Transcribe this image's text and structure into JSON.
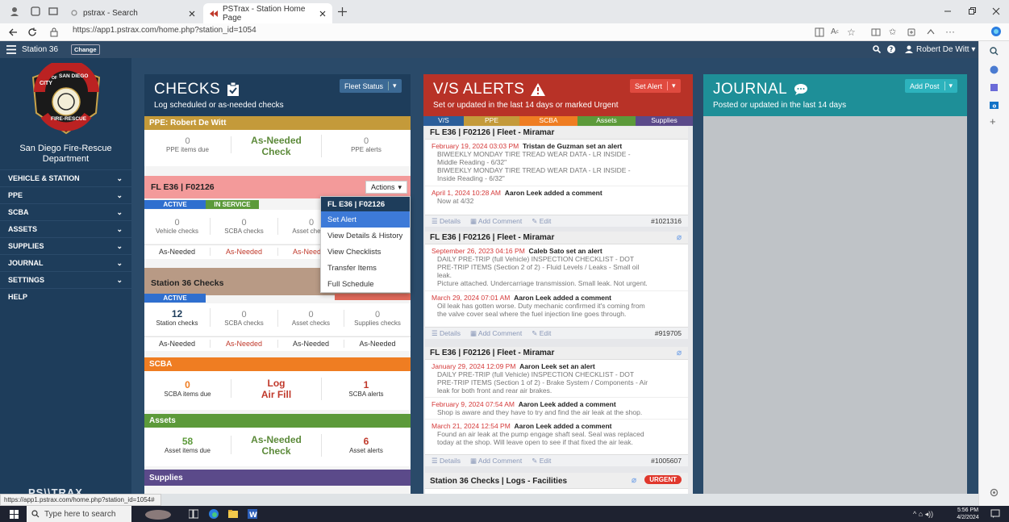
{
  "browser": {
    "tabs": [
      {
        "label": "pstrax - Search"
      },
      {
        "label": "PSTrax - Station Home Page"
      }
    ],
    "url": "https://app1.pstrax.com/home.php?station_id=1054"
  },
  "nav": {
    "station": "Station 36",
    "change_label": "Change",
    "user": "Robert De Witt"
  },
  "sidebar": {
    "org_name": "San Diego Fire-Rescue Department",
    "logo_text": [
      "CITY",
      "OF",
      "SAN DIEGO",
      "FIRE-RESCUE"
    ],
    "items": [
      {
        "label": "VEHICLE & STATION"
      },
      {
        "label": "PPE"
      },
      {
        "label": "SCBA"
      },
      {
        "label": "ASSETS"
      },
      {
        "label": "SUPPLIES"
      },
      {
        "label": "JOURNAL"
      },
      {
        "label": "SETTINGS"
      },
      {
        "label": "HELP"
      }
    ],
    "footer_logo": "PS\\\\TRAX"
  },
  "checks": {
    "title": "CHECKS",
    "subtitle": "Log scheduled or as-needed checks",
    "fleet_btn": "Fleet Status",
    "ppe": {
      "header": "PPE: Robert De Witt",
      "items_due": "0",
      "items_due_label": "PPE items due",
      "check_line1": "As-Needed",
      "check_line2": "Check",
      "alerts": "0",
      "alerts_label": "PPE alerts"
    },
    "vehicle": {
      "header": "FL E36 | F02126",
      "actions": "Actions",
      "badge_active": "ACTIVE",
      "badge_service": "IN SERVICE",
      "cells": [
        {
          "num": "0",
          "label": "Vehicle checks",
          "as": "As-Needed"
        },
        {
          "num": "0",
          "label": "SCBA checks",
          "as": "As-Needed"
        },
        {
          "num": "0",
          "label": "Asset checks",
          "as": "As-Needed"
        }
      ]
    },
    "station": {
      "header": "Station 36 Checks",
      "badge": "ACTIVE",
      "cells": [
        {
          "num": "12",
          "label": "Station checks",
          "as": "As-Needed"
        },
        {
          "num": "0",
          "label": "SCBA checks",
          "as": "As-Needed"
        },
        {
          "num": "0",
          "label": "Asset checks",
          "as": "As-Needed"
        },
        {
          "num": "0",
          "label": "Supplies checks",
          "as": "As-Needed"
        }
      ]
    },
    "scba": {
      "header": "SCBA",
      "items_due": "0",
      "items_due_label": "SCBA items due",
      "log_line1": "Log",
      "log_line2": "Air Fill",
      "alerts": "1",
      "alerts_label": "SCBA alerts"
    },
    "assets": {
      "header": "Assets",
      "items_due": "58",
      "items_due_label": "Asset items due",
      "check_line1": "As-Needed",
      "check_line2": "Check",
      "alerts": "6",
      "alerts_label": "Asset alerts"
    },
    "supplies": {
      "header": "Supplies"
    }
  },
  "menu": {
    "header": "FL E36 | F02126",
    "items": [
      {
        "label": "Set Alert"
      },
      {
        "label": "View Details & History"
      },
      {
        "label": "View Checklists"
      },
      {
        "label": "Transfer Items"
      },
      {
        "label": "Full Schedule"
      }
    ]
  },
  "alerts": {
    "title": "V/S ALERTS",
    "subtitle": "Set or updated in the last 14 days or marked Urgent",
    "set_btn": "Set Alert",
    "tabs": [
      {
        "label": "V/S"
      },
      {
        "label": "PPE"
      },
      {
        "label": "SCBA"
      },
      {
        "label": "Assets"
      },
      {
        "label": "Supplies"
      }
    ],
    "cards": [
      {
        "header": "FL E36 | F02126 | Fleet - Miramar",
        "entries": [
          {
            "date": "February 19, 2024 03:03 PM",
            "who": "Tristan de Guzman set an alert",
            "text": [
              "BIWEEKLY MONDAY TIRE TREAD WEAR DATA - LR INSIDE -",
              "Middle Reading - 6/32\"",
              "BIWEEKLY MONDAY TIRE TREAD WEAR DATA - LR INSIDE -",
              "Inside Reading - 6/32\""
            ]
          },
          {
            "date": "April 1, 2024 10:28 AM",
            "who": "Aaron Leek added a comment",
            "text": [
              "Now at 4/32"
            ]
          }
        ],
        "ref": "#1021316"
      },
      {
        "header": "FL E36 | F02126 | Fleet - Miramar",
        "entries": [
          {
            "date": "September 26, 2023 04:16 PM",
            "who": "Caleb Sato set an alert",
            "text": [
              "DAILY PRE-TRIP (full Vehicle) INSPECTION CHECKLIST - DOT",
              "PRE-TRIP ITEMS (Section 2 of 2) - Fluid Levels / Leaks - Small oil",
              "leak.",
              "Picture attached. Undercarriage transmission. Small leak. Not urgent."
            ]
          },
          {
            "date": "March 29, 2024 07:01 AM",
            "who": "Aaron Leek added a comment",
            "text": [
              "Oil leak has gotten worse. Duty mechanic confirmed it's coming from",
              "the valve cover seal where the fuel injection line goes through."
            ]
          }
        ],
        "ref": "#919705"
      },
      {
        "header": "FL E36 | F02126 | Fleet - Miramar",
        "entries": [
          {
            "date": "January 29, 2024 12:09 PM",
            "who": "Aaron Leek set an alert",
            "text": [
              "DAILY PRE-TRIP (full Vehicle) INSPECTION CHECKLIST - DOT",
              "PRE-TRIP ITEMS (Section 1 of 2) - Brake System / Components - Air",
              "leak for both front and rear air brakes."
            ]
          },
          {
            "date": "February 9, 2024 07:54 AM",
            "who": "Aaron Leek added a comment",
            "text": [
              "Shop is aware and they have to try and find the air leak at the shop."
            ]
          },
          {
            "date": "March 21, 2024 12:54 PM",
            "who": "Aaron Leek added a comment",
            "text": [
              "Found an air leak at the pump engage shaft seal. Seal was replaced",
              "today at the shop. Will leave open to see if that fixed the air leak."
            ]
          }
        ],
        "ref": "#1005607"
      },
      {
        "header": "Station 36 Checks | Logs - Facilities",
        "urgent": "URGENT"
      }
    ],
    "foot": {
      "details": "Details",
      "add_comment": "Add Comment",
      "edit": "Edit"
    }
  },
  "journal": {
    "title": "JOURNAL",
    "subtitle": "Posted or updated in the last 14 days",
    "add_btn": "Add Post"
  },
  "status_url": "https://app1.pstrax.com/home.php?station_id=1054#",
  "taskbar": {
    "search": "Type here to search",
    "time": "5:56 PM",
    "date": "4/2/2024"
  },
  "colors": {
    "checks": "#1e3d5b",
    "alerts": "#b83227",
    "journal": "#1e8f98",
    "ppe": "#c49a3a",
    "vehicle": "#f39a9a",
    "station": "#b89a85",
    "scba": "#ef7d22",
    "assets": "#5c9a3a",
    "supplies": "#5b4a8a"
  }
}
